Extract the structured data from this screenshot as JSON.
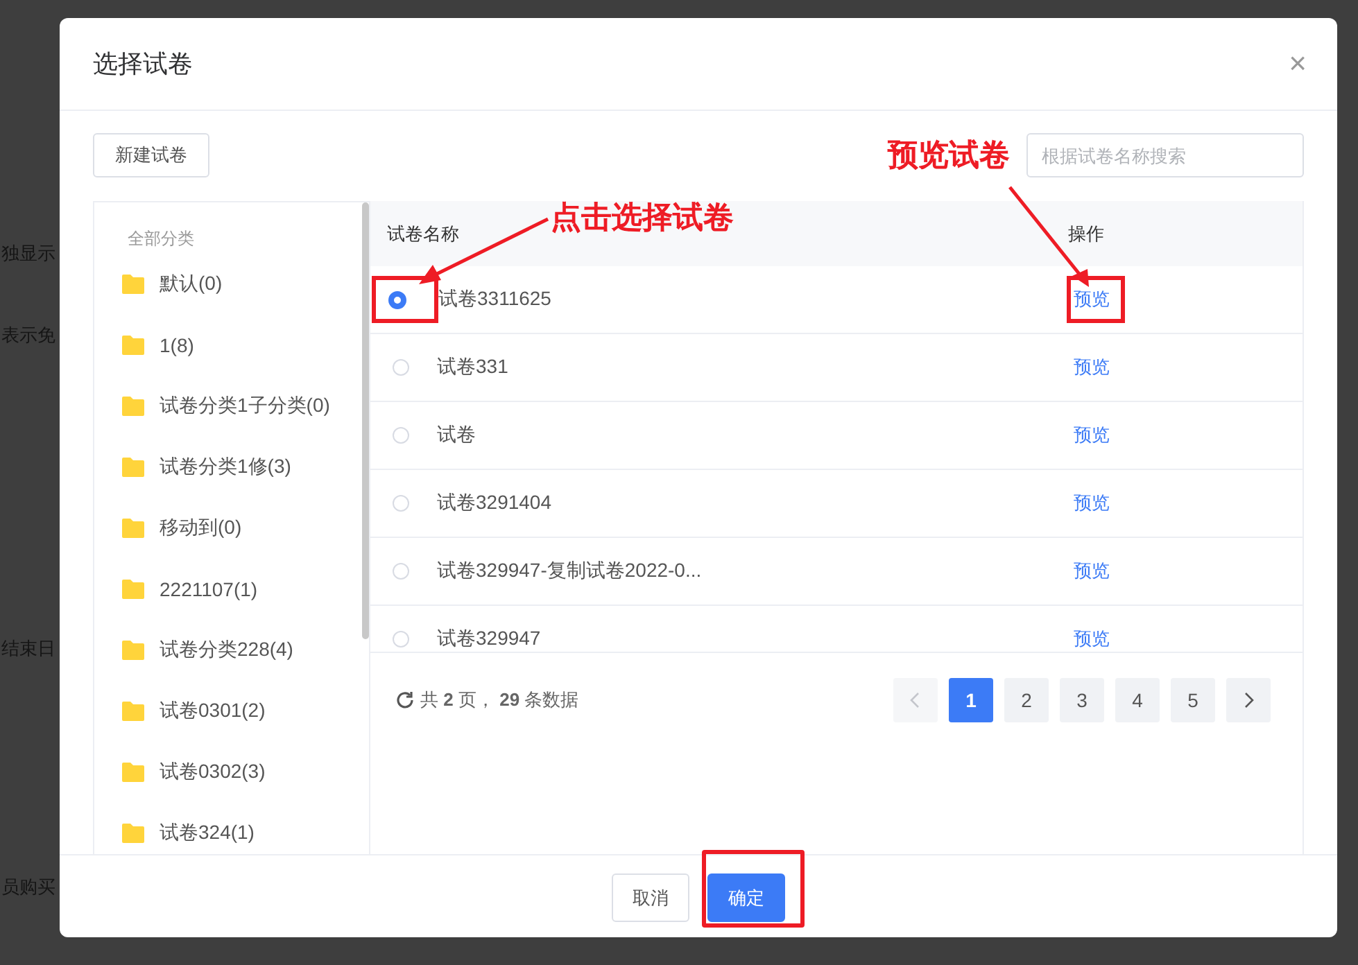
{
  "background": {
    "fragments": [
      "独显示",
      "表示免",
      "结束日",
      "员购买"
    ]
  },
  "dialog": {
    "title": "选择试卷",
    "close": "×",
    "toolbar": {
      "new_button": "新建试卷",
      "search": {
        "placeholder": "根据试卷名称搜索"
      }
    },
    "sidebar": {
      "heading": "全部分类",
      "items": [
        {
          "label": "默认(0)"
        },
        {
          "label": "1(8)"
        },
        {
          "label": "试卷分类1子分类(0)"
        },
        {
          "label": "试卷分类1修(3)"
        },
        {
          "label": "移动到(0)"
        },
        {
          "label": "2221107(1)"
        },
        {
          "label": "试卷分类228(4)"
        },
        {
          "label": "试卷0301(2)"
        },
        {
          "label": "试卷0302(3)"
        },
        {
          "label": "试卷324(1)"
        }
      ]
    },
    "table": {
      "columns": [
        "试卷名称",
        "操作"
      ],
      "rows": [
        {
          "name": "试卷3311625",
          "action": "预览",
          "selected": true,
          "radio_marked": true,
          "action_marked": true
        },
        {
          "name": "试卷331",
          "action": "预览",
          "selected": false,
          "radio_marked": false,
          "action_marked": false
        },
        {
          "name": "试卷",
          "action": "预览",
          "selected": false,
          "radio_marked": false,
          "action_marked": false
        },
        {
          "name": "试卷3291404",
          "action": "预览",
          "selected": false,
          "radio_marked": false,
          "action_marked": false
        },
        {
          "name": "试卷329947-复制试卷2022-0...",
          "action": "预览",
          "selected": false,
          "radio_marked": false,
          "action_marked": false
        },
        {
          "name": "试卷329947",
          "action": "预览",
          "selected": false,
          "radio_marked": false,
          "action_marked": false
        }
      ]
    },
    "summary": "共 **2** 页， **29** 条数据",
    "pagination": {
      "prev": {
        "disabled": true
      },
      "pages": [
        {
          "label": "1",
          "selected": true
        },
        {
          "label": "2",
          "selected": false
        },
        {
          "label": "3",
          "selected": false
        },
        {
          "label": "4",
          "selected": false
        },
        {
          "label": "5",
          "selected": false
        }
      ],
      "next": {
        "disabled": false
      }
    },
    "footer": {
      "cancel": "取消",
      "confirm": {
        "label": "确定",
        "marked": true
      }
    }
  },
  "annotations": [
    {
      "kind": "select",
      "text": "点击选择试卷"
    },
    {
      "kind": "preview",
      "text": "预览试卷"
    }
  ]
}
